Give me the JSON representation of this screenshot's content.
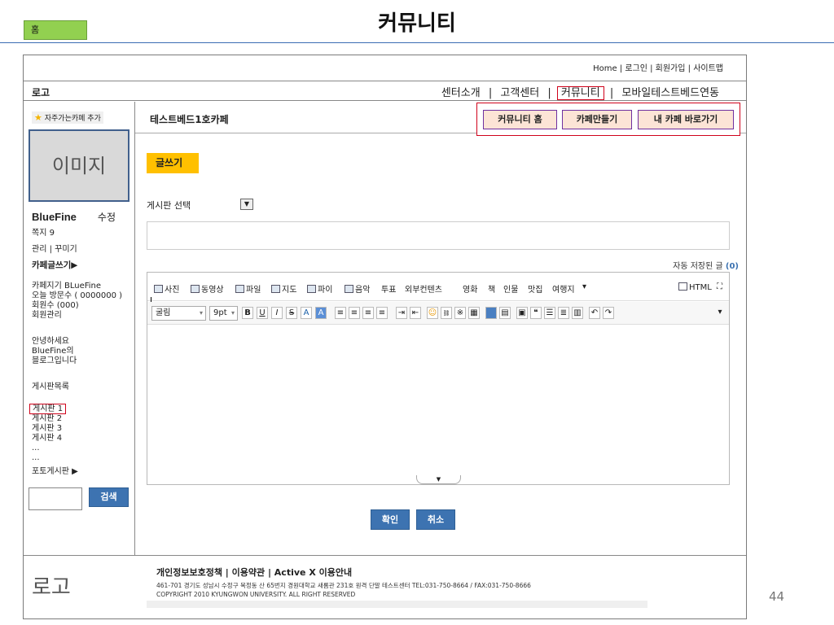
{
  "slide": {
    "home_tab": "홈",
    "title": "커뮤니티",
    "page_number": "44"
  },
  "top_links": "Home | 로그인 | 회원가입 | 사이트맵",
  "header": {
    "logo": "로고",
    "nav": [
      "센터소개",
      "|",
      "고객센터",
      "|",
      "커뮤니티",
      "|",
      "모바일테스트베드연동"
    ]
  },
  "sidebar": {
    "favorite": "자주가는카페 추가",
    "image_placeholder": "이미지",
    "user_name": "BlueFine",
    "edit_label": "수정",
    "note": "쪽지 9",
    "manage": "관리 | 꾸미기",
    "cafe_write": "카페글쓰기▶",
    "cafe_keeper": "카페지기 BLueFine",
    "today_visits": "오늘 방문수 ( 0000000 )",
    "member_count": "회원수 (000)",
    "member_manage": "회원관리",
    "greeting_1": "안녕하세요",
    "greeting_2": "BlueFine의",
    "greeting_3": "블로그입니다",
    "board_list_title": "게시판목록",
    "boards": [
      "게시판 1",
      "게시판 2",
      "게시판 3",
      "게시판 4",
      "...",
      "..."
    ],
    "photo_board": "포토게시판 ▶",
    "search_button": "검색"
  },
  "main": {
    "cafe_name": "테스트베드1호카페",
    "buttons": [
      "커뮤니티 홈",
      "카페만들기",
      "내 카페 바로가기"
    ],
    "write_tab": "글쓰기",
    "board_select": "게시판 선택",
    "autosave_label": "자동 저장된 글",
    "autosave_count": "(0)",
    "toolbar1": [
      "사진",
      "동영상",
      "파일",
      "지도",
      "파이",
      "음악",
      "투표",
      "외부컨텐츠",
      "영화",
      "책",
      "인물",
      "맛집",
      "여행지"
    ],
    "html_label": "HTML",
    "font_name": "굴림",
    "font_size": "9pt",
    "confirm_button": "확인",
    "cancel_button": "취소"
  },
  "footer": {
    "logo": "로고",
    "links": "개인정보보호정책 | 이용약관 | Active X 이용안내",
    "address": "461-701 경기도 성남시 수정구 복정동 산 65번지 경원대학교 새롬관 231호 원격 단말 테스트센터 TEL:031-750-8664 / FAX:031-750-8666",
    "copyright": "COPYRIGHT 2010 KYUNGWON UNIVERSITY. ALL RIGHT RESERVED"
  },
  "colors": {
    "accent_blue": "#3d73b1",
    "highlight_red": "#d0021b",
    "home_tab_green": "#92d050",
    "write_tab_yellow": "#ffc000",
    "cafe_button_fill": "#fce4d6"
  }
}
